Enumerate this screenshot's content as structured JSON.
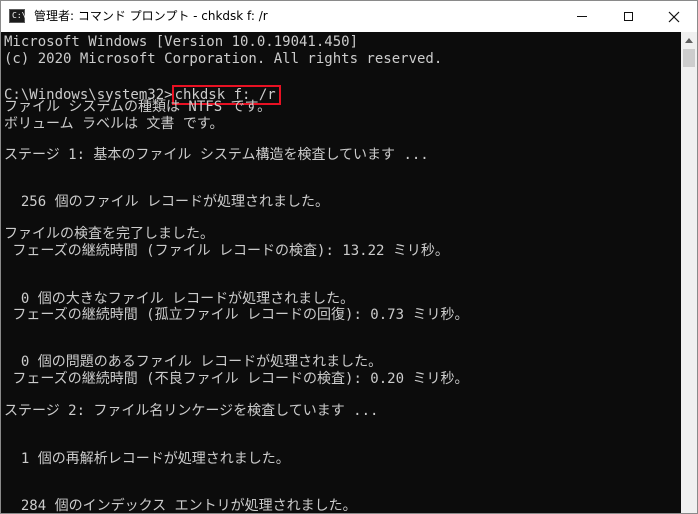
{
  "window": {
    "title": "管理者: コマンド プロンプト - chkdsk  f: /r",
    "icon": "cmd-icon",
    "icon_text": "C:\\",
    "controls": [
      "minimize-icon",
      "maximize-icon",
      "close-icon"
    ]
  },
  "console": {
    "lines": [
      "Microsoft Windows [Version 10.0.19041.450]",
      "(c) 2020 Microsoft Corporation. All rights reserved.",
      "",
      "",
      "ファイル システムの種類は NTFS です。",
      "ボリューム ラベルは 文書 です。",
      "",
      "ステージ 1: 基本のファイル システム構造を検査しています ...",
      "",
      "",
      "  256 個のファイル レコードが処理されました。",
      "",
      "ファイルの検査を完了しました。",
      " フェーズの継続時間 (ファイル レコードの検査): 13.22 ミリ秒。",
      "",
      "",
      "  0 個の大きなファイル レコードが処理されました。",
      " フェーズの継続時間 (孤立ファイル レコードの回復): 0.73 ミリ秒。",
      "",
      "",
      "  0 個の問題のあるファイル レコードが処理されました。",
      " フェーズの継続時間 (不良ファイル レコードの検査): 0.20 ミリ秒。",
      "",
      "ステージ 2: ファイル名リンケージを検査しています ...",
      "",
      "",
      "  1 個の再解析レコードが処理されました。",
      "",
      "",
      "  284 個のインデックス エントリが処理されました。"
    ],
    "prompt": "C:\\Windows\\system32>",
    "command": "chkdsk f: /r",
    "colors": {
      "background": "#0c0c0c",
      "text": "#cccccc",
      "highlight_border": "#e81123"
    }
  },
  "scrollbar": {
    "up_arrow": "chevron-up-icon"
  }
}
